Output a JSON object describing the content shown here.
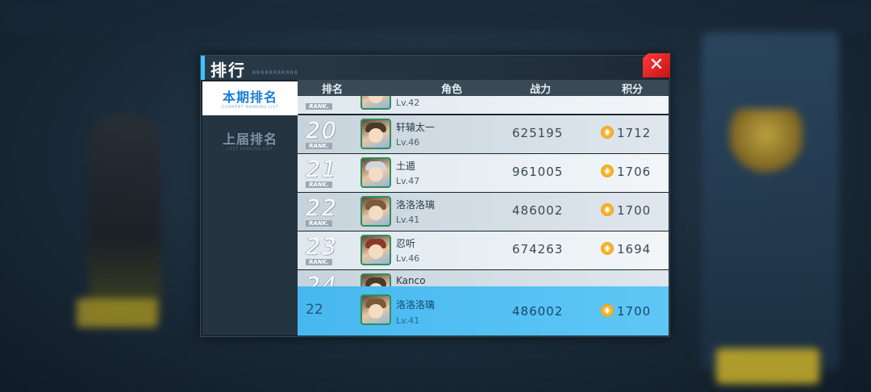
{
  "panel": {
    "title": "排行",
    "subtitle": "RRRRRRRRRRR"
  },
  "tabs": [
    {
      "label": "本期排名",
      "sub": "CURRENT RANKING LIST",
      "active": true
    },
    {
      "label": "上届排名",
      "sub": "LAST RANKING LIST",
      "active": false
    }
  ],
  "table": {
    "headers": {
      "rank": "排名",
      "character": "角色",
      "power": "战力",
      "score": "积分"
    },
    "rank_word": "RANK.",
    "partial_top": {
      "level": "Lv.42"
    },
    "rows": [
      {
        "rank": "20",
        "name": "轩辕太一",
        "level": "Lv.46",
        "power": "625195",
        "score": "1712"
      },
      {
        "rank": "21",
        "name": "土遁",
        "level": "Lv.47",
        "power": "961005",
        "score": "1706"
      },
      {
        "rank": "22",
        "name": "洛洛洛璃",
        "level": "Lv.41",
        "power": "486002",
        "score": "1700"
      },
      {
        "rank": "23",
        "name": "忍听",
        "level": "Lv.46",
        "power": "674263",
        "score": "1694"
      }
    ],
    "partial_bottom": {
      "rank": "24",
      "name": "Kanco"
    }
  },
  "my_rank": {
    "rank": "22",
    "name": "洛洛洛璃",
    "level": "Lv.41",
    "power": "486002",
    "score": "1700"
  },
  "icons": {
    "close": "close-icon",
    "score": "score-medal-icon"
  },
  "colors": {
    "accent": "#3fc3ff",
    "close": "#e02a2a",
    "my_rank_bg": "#4dbdf1"
  }
}
